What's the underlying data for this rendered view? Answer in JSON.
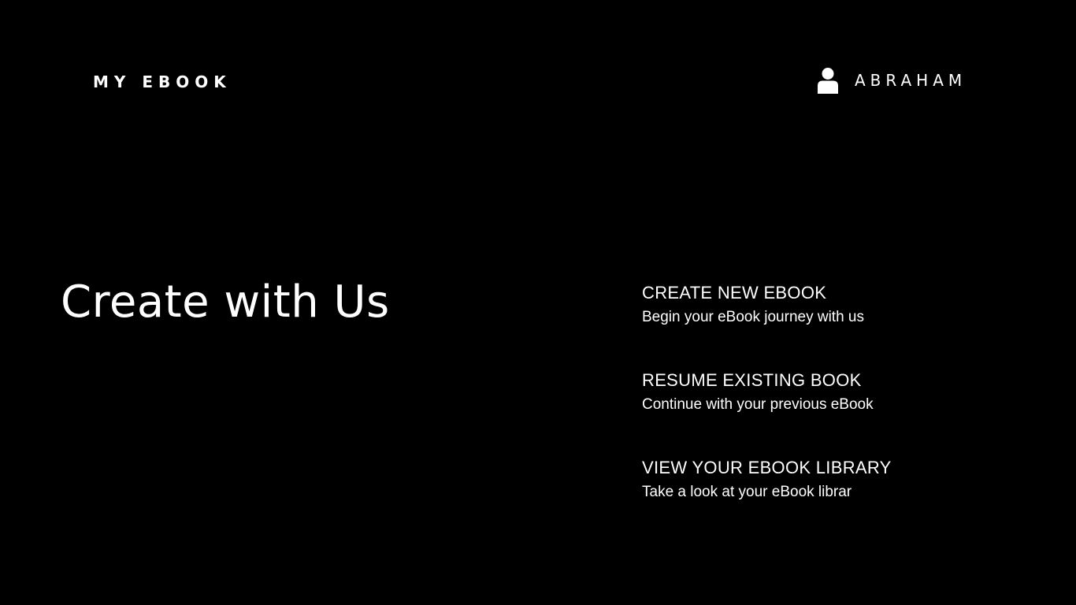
{
  "header": {
    "brand": "MY EBOOK",
    "user_icon": "user-icon",
    "user_name": "ABRAHAM"
  },
  "hero": {
    "title": "Create with Us"
  },
  "actions": [
    {
      "title": "CREATE NEW EBOOK",
      "description": "Begin your eBook journey with us"
    },
    {
      "title": "RESUME EXISTING BOOK",
      "description": "Continue with your previous eBook"
    },
    {
      "title": "VIEW YOUR EBOOK LIBRARY",
      "description": "Take a look at your eBook librar"
    }
  ],
  "colors": {
    "background": "#000000",
    "text": "#ffffff"
  }
}
